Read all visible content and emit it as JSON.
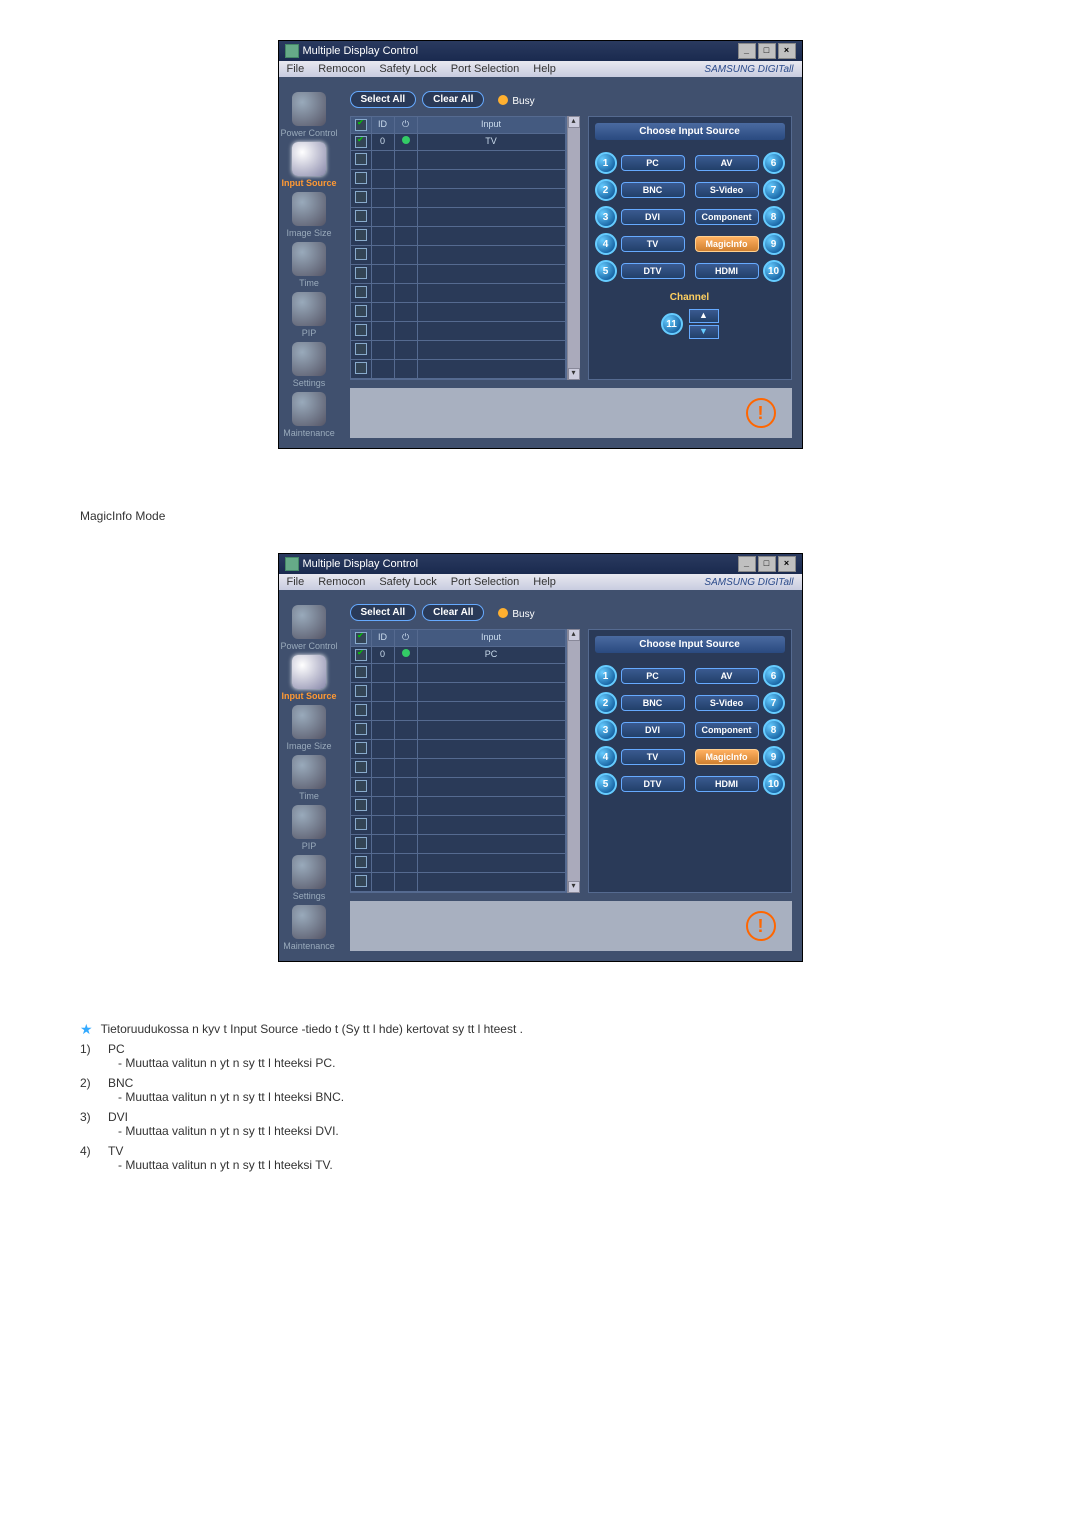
{
  "window": {
    "title": "Multiple Display Control",
    "menus": [
      "File",
      "Remocon",
      "Safety Lock",
      "Port Selection",
      "Help"
    ],
    "brand": "SAMSUNG DIGITall"
  },
  "sidebar": {
    "items": [
      {
        "label": "Power Control"
      },
      {
        "label": "Input Source",
        "active": true
      },
      {
        "label": "Image Size"
      },
      {
        "label": "Time"
      },
      {
        "label": "PIP"
      },
      {
        "label": "Settings"
      },
      {
        "label": "Maintenance"
      }
    ]
  },
  "toolbar": {
    "select_all": "Select All",
    "clear_all": "Clear All",
    "busy": "Busy"
  },
  "table": {
    "headers": {
      "chk": "☑",
      "id": "ID",
      "status": "⏻",
      "input": "Input"
    },
    "row1_tv": {
      "id": "0",
      "input": "TV"
    },
    "row1_pc": {
      "id": "0",
      "input": "PC"
    }
  },
  "panel": {
    "title": "Choose Input Source",
    "left": [
      {
        "n": "1",
        "label": "PC"
      },
      {
        "n": "2",
        "label": "BNC"
      },
      {
        "n": "3",
        "label": "DVI"
      },
      {
        "n": "4",
        "label": "TV"
      },
      {
        "n": "5",
        "label": "DTV"
      }
    ],
    "right": [
      {
        "n": "6",
        "label": "AV"
      },
      {
        "n": "7",
        "label": "S-Video"
      },
      {
        "n": "8",
        "label": "Component"
      },
      {
        "n": "9",
        "label": "MagicInfo",
        "hl": true
      },
      {
        "n": "10",
        "label": "HDMI"
      }
    ],
    "channel_label": "Channel",
    "channel_badge": "11"
  },
  "mode_heading": "MagicInfo Mode",
  "notes": {
    "intro": "Tietoruudukossa n kyv t Input Source -tiedo  t (Sy tt l hde) kertovat sy tt l hteest .",
    "items": [
      {
        "n": "1)",
        "title": "PC",
        "desc": "- Muuttaa valitun n yt n sy tt l hteeksi PC."
      },
      {
        "n": "2)",
        "title": "BNC",
        "desc": "- Muuttaa valitun n yt n sy tt l hteeksi BNC."
      },
      {
        "n": "3)",
        "title": "DVI",
        "desc": "- Muuttaa valitun n yt n sy tt l hteeksi DVI."
      },
      {
        "n": "4)",
        "title": "TV",
        "desc": "- Muuttaa valitun n yt n sy tt l hteeksi TV."
      }
    ]
  }
}
